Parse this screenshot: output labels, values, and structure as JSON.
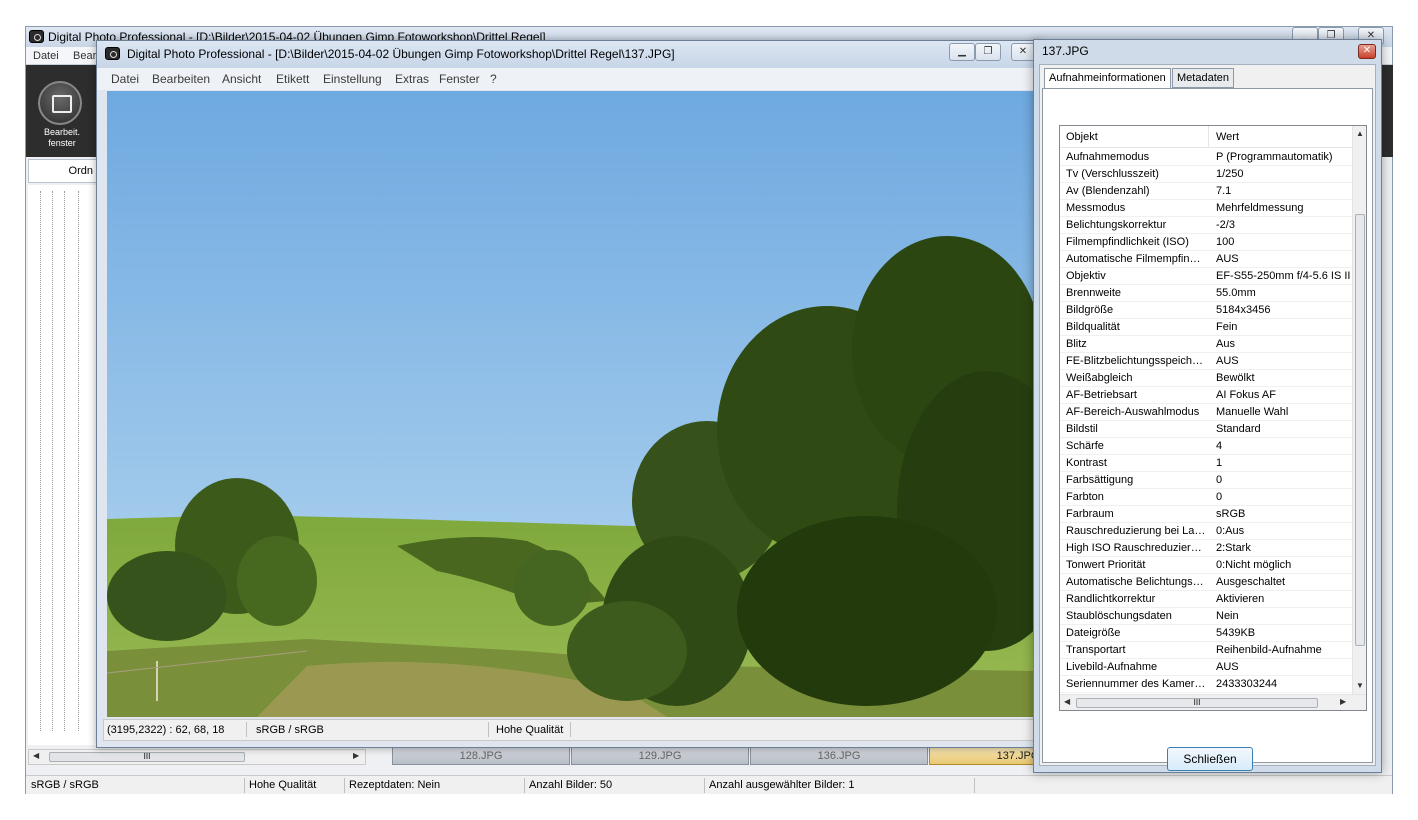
{
  "main_window": {
    "title": "Digital Photo Professional - [D:\\Bilder\\2015-04-02 Übungen  Gimp Fotoworkshop\\Drittel Regel]",
    "menu": [
      "Datei",
      "Bear"
    ],
    "toolbar": {
      "edit_button_label": "Bearbeit.\nfenster"
    },
    "folder_tab_label": "Ordn",
    "thumbnail_tabs": [
      "128.JPG",
      "129.JPG",
      "136.JPG",
      "137.JPG"
    ],
    "status": {
      "color_space": "sRGB / sRGB",
      "quality": "Hohe Qualität",
      "recipe": "Rezeptdaten: Nein",
      "image_count": "Anzahl Bilder: 50",
      "selected_count": "Anzahl ausgewählter Bilder: 1"
    },
    "scroll_glyph": "III"
  },
  "editor_window": {
    "title": "Digital Photo Professional - [D:\\Bilder\\2015-04-02 Übungen  Gimp Fotoworkshop\\Drittel Regel\\137.JPG]",
    "menu": [
      "Datei",
      "Bearbeiten",
      "Ansicht",
      "Etikett",
      "Einstellung",
      "Extras",
      "Fenster",
      "?"
    ],
    "status": {
      "pixel_info": "(3195,2322) :  62, 68, 18",
      "color_space": "sRGB / sRGB",
      "quality": "Hohe Qualität"
    }
  },
  "info_dialog": {
    "title": "137.JPG",
    "tabs": [
      "Aufnahmeinformationen",
      "Metadaten"
    ],
    "active_tab": "Aufnahmeinformationen",
    "columns": [
      "Objekt",
      "Wert"
    ],
    "rows": [
      [
        "Aufnahmemodus",
        "P (Programmautomatik)"
      ],
      [
        "Tv (Verschlusszeit)",
        "1/250"
      ],
      [
        "Av (Blendenzahl)",
        "7.1"
      ],
      [
        "Messmodus",
        "Mehrfeldmessung"
      ],
      [
        "Belichtungskorrektur",
        "-2/3"
      ],
      [
        "Filmempfindlichkeit (ISO)",
        "100"
      ],
      [
        "Automatische Filmempfindli...",
        "AUS"
      ],
      [
        "Objektiv",
        "EF-S55-250mm f/4-5.6 IS II"
      ],
      [
        "Brennweite",
        "55.0mm"
      ],
      [
        "Bildgröße",
        "5184x3456"
      ],
      [
        "Bildqualität",
        "Fein"
      ],
      [
        "Blitz",
        "Aus"
      ],
      [
        "FE-Blitzbelichtungsspeicher...",
        "AUS"
      ],
      [
        "Weißabgleich",
        "Bewölkt"
      ],
      [
        "AF-Betriebsart",
        "AI Fokus AF"
      ],
      [
        "AF-Bereich-Auswahlmodus",
        "Manuelle  Wahl"
      ],
      [
        "Bildstil",
        "Standard"
      ],
      [
        "Schärfe",
        "4"
      ],
      [
        "Kontrast",
        "1"
      ],
      [
        "Farbsättigung",
        "0"
      ],
      [
        "Farbton",
        "0"
      ],
      [
        "Farbraum",
        "sRGB"
      ],
      [
        "Rauschreduzierung bei Lan...",
        "0:Aus"
      ],
      [
        "High ISO Rauschreduzierung",
        "2:Stark"
      ],
      [
        "Tonwert Priorität",
        "0:Nicht möglich"
      ],
      [
        "Automatische Belichtungso...",
        "Ausgeschaltet"
      ],
      [
        "Randlichtkorrektur",
        "Aktivieren"
      ],
      [
        "Staublöschungsdaten",
        "Nein"
      ],
      [
        "Dateigröße",
        "5439KB"
      ],
      [
        "Transportart",
        "Reihenbild-Aufnahme"
      ],
      [
        "Livebild-Aufnahme",
        "AUS"
      ],
      [
        "Seriennummer des Kamera...",
        "2433303244"
      ]
    ],
    "close_button_label": "Schließen",
    "scroll_glyph": "III"
  },
  "colors": {
    "sky": "#78b3e6",
    "foliage": "#2f4a12",
    "meadow": "#86ad3f",
    "dialog_frame": "#cfdbe9",
    "close_accent": "#c8412d"
  }
}
